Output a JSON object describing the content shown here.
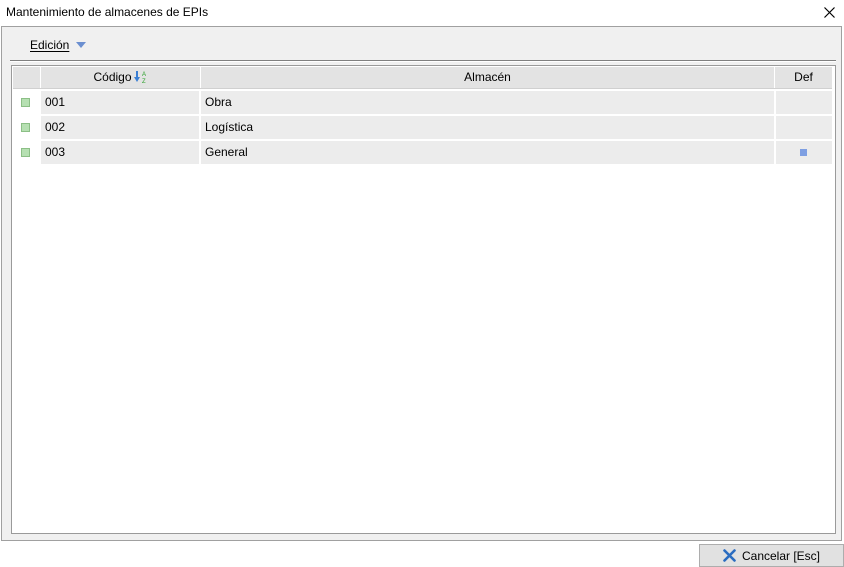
{
  "window": {
    "title": "Mantenimiento de almacenes de EPIs",
    "close_icon": "close-icon"
  },
  "menu": {
    "edicion_label": "Edición",
    "dropdown_icon": "triangle-down-icon"
  },
  "grid": {
    "columns": [
      {
        "key": "codigo",
        "label": "Código",
        "sort_icon": "sort-az-icon"
      },
      {
        "key": "almacen",
        "label": "Almacén"
      },
      {
        "key": "def",
        "label": "Def"
      }
    ],
    "rows": [
      {
        "codigo": "001",
        "almacen": "Obra",
        "def": false
      },
      {
        "codigo": "002",
        "almacen": "Logística",
        "def": false
      },
      {
        "codigo": "003",
        "almacen": "General",
        "def": true
      }
    ]
  },
  "footer": {
    "cancel_label": "Cancelar [Esc]",
    "cancel_icon": "x-icon"
  },
  "colors": {
    "row_indicator": "#b6e0b2",
    "def_marker": "#7e9fe2",
    "sort_arrow": "#3b7fd4",
    "cancel_x": "#2a6cc0",
    "dropdown_arrow": "#6b8fd0"
  }
}
